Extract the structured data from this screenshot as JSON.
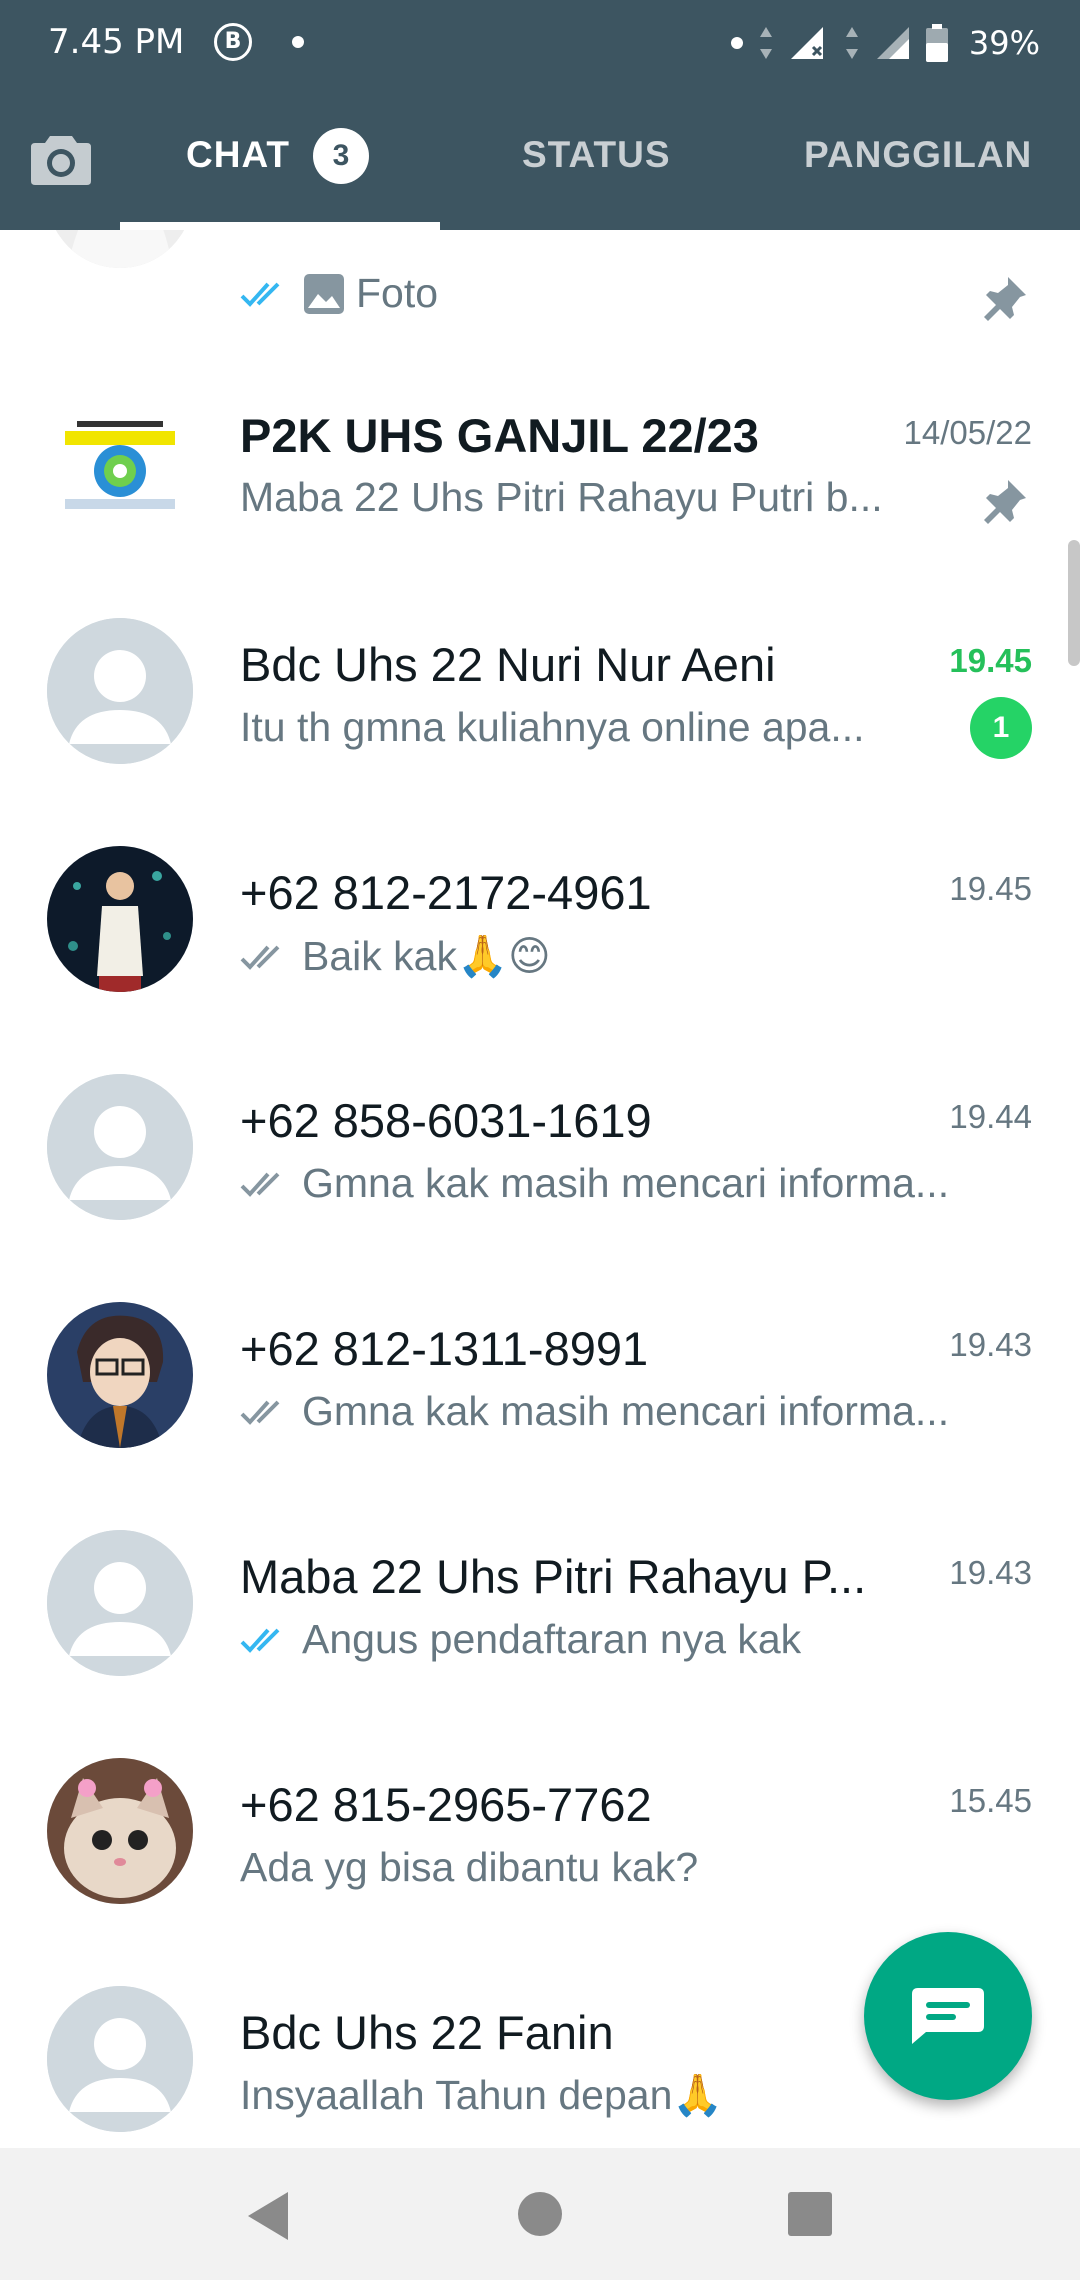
{
  "status_bar": {
    "time": "7.45 PM",
    "b_icon": "B",
    "battery": "39%"
  },
  "tabs": {
    "chat": "CHAT",
    "chat_badge": "3",
    "status": "STATUS",
    "calls": "PANGGILAN"
  },
  "chats": [
    {
      "name": "",
      "time": "",
      "preview": "Foto",
      "ticks": "blue",
      "pinned": true,
      "avatar": "photo-white-clothes"
    },
    {
      "name": "P2K UHS GANJIL 22/23",
      "time": "14/05/22",
      "preview": "Maba 22 Uhs Pitri Rahayu Putri b...",
      "ticks": "none",
      "pinned": true,
      "avatar": "group-logo"
    },
    {
      "name": "Bdc Uhs 22 Nuri Nur Aeni",
      "time": "19.45",
      "preview": "Itu th gmna kuliahnya online apa...",
      "ticks": "none",
      "unread": "1",
      "avatar": "default"
    },
    {
      "name": "+62 812-2172-4961",
      "time": "19.45",
      "preview": "Baik kak🙏😊",
      "ticks": "grey",
      "avatar": "photo-child"
    },
    {
      "name": "+62 858-6031-1619",
      "time": "19.44",
      "preview": "Gmna kak masih mencari informa...",
      "ticks": "grey",
      "avatar": "default"
    },
    {
      "name": "+62 812-1311-8991",
      "time": "19.43",
      "preview": "Gmna kak masih mencari informa...",
      "ticks": "grey",
      "avatar": "anime-glasses"
    },
    {
      "name": "Maba 22 Uhs Pitri Rahayu P...",
      "time": "19.43",
      "preview": "Angus pendaftaran nya kak",
      "ticks": "blue",
      "avatar": "default"
    },
    {
      "name": "+62 815-2965-7762",
      "time": "15.45",
      "preview": "Ada yg bisa dibantu kak?",
      "ticks": "none",
      "avatar": "cat-photo"
    },
    {
      "name": "Bdc Uhs 22 Fanin",
      "time": "",
      "preview": "Insyaallah Tahun depan🙏",
      "ticks": "none",
      "avatar": "default"
    }
  ],
  "icons": {
    "camera": "camera-icon",
    "pin": "pin-icon",
    "photo": "image-icon",
    "fab": "new-chat-icon",
    "nav_back": "back-triangle-icon",
    "nav_home": "home-circle-icon",
    "nav_recent": "recents-square-icon"
  },
  "colors": {
    "header": "#3d5561",
    "accent": "#00a884",
    "unread": "#25d366",
    "read_tick": "#34b7f1"
  }
}
